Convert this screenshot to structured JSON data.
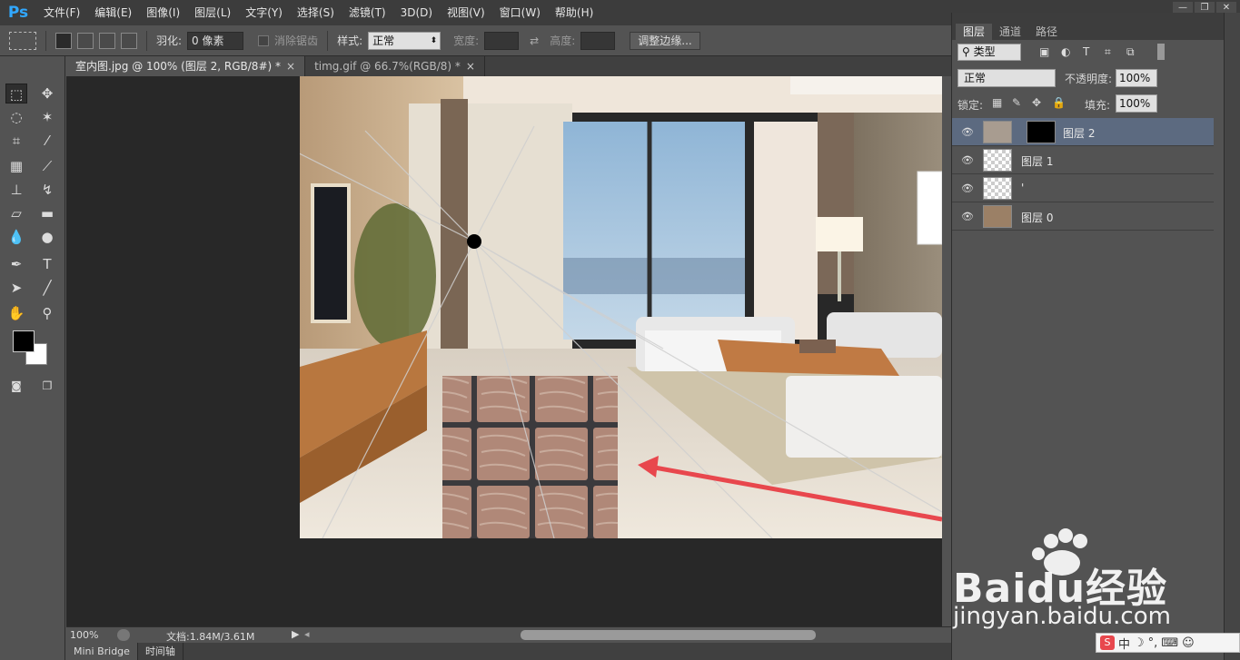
{
  "app": {
    "logo": "Ps"
  },
  "menu": [
    "文件(F)",
    "编辑(E)",
    "图像(I)",
    "图层(L)",
    "文字(Y)",
    "选择(S)",
    "滤镜(T)",
    "3D(D)",
    "视图(V)",
    "窗口(W)",
    "帮助(H)"
  ],
  "options": {
    "feather_label": "羽化:",
    "feather_value": "0 像素",
    "antialias_label": "消除锯齿",
    "style_label": "样式:",
    "style_value": "正常",
    "width_label": "宽度:",
    "height_label": "高度:",
    "refine_button": "调整边缘..."
  },
  "tabs": [
    {
      "label": "室内图.jpg @ 100% (图层 2, RGB/8#) *",
      "close": "×"
    },
    {
      "label": "timg.gif @ 66.7%(RGB/8) *",
      "close": "×"
    }
  ],
  "status": {
    "zoom": "100%",
    "doc_info": "文档:1.84M/3.61M"
  },
  "bottom_tabs": [
    "Mini Bridge",
    "时间轴"
  ],
  "layers_panel": {
    "tabs": [
      "图层",
      "通道",
      "路径"
    ],
    "filter_label": "类型",
    "blend_mode": "正常",
    "opacity_label": "不透明度:",
    "opacity_value": "100%",
    "lock_label": "锁定:",
    "fill_label": "填充:",
    "fill_value": "100%",
    "layers": [
      {
        "name": "图层 2",
        "selected": true
      },
      {
        "name": "图层 1",
        "selected": false
      },
      {
        "name": "'",
        "selected": false
      },
      {
        "name": "图层 0",
        "selected": false
      }
    ]
  },
  "watermark": {
    "brand": "Baidu经验",
    "url": "jingyan.baidu.com"
  },
  "ime": {
    "label": "中"
  },
  "colors": {
    "accent_ps": "#31a8ff",
    "selected_layer": "#5c6a80",
    "arrow": "#e8474d"
  }
}
